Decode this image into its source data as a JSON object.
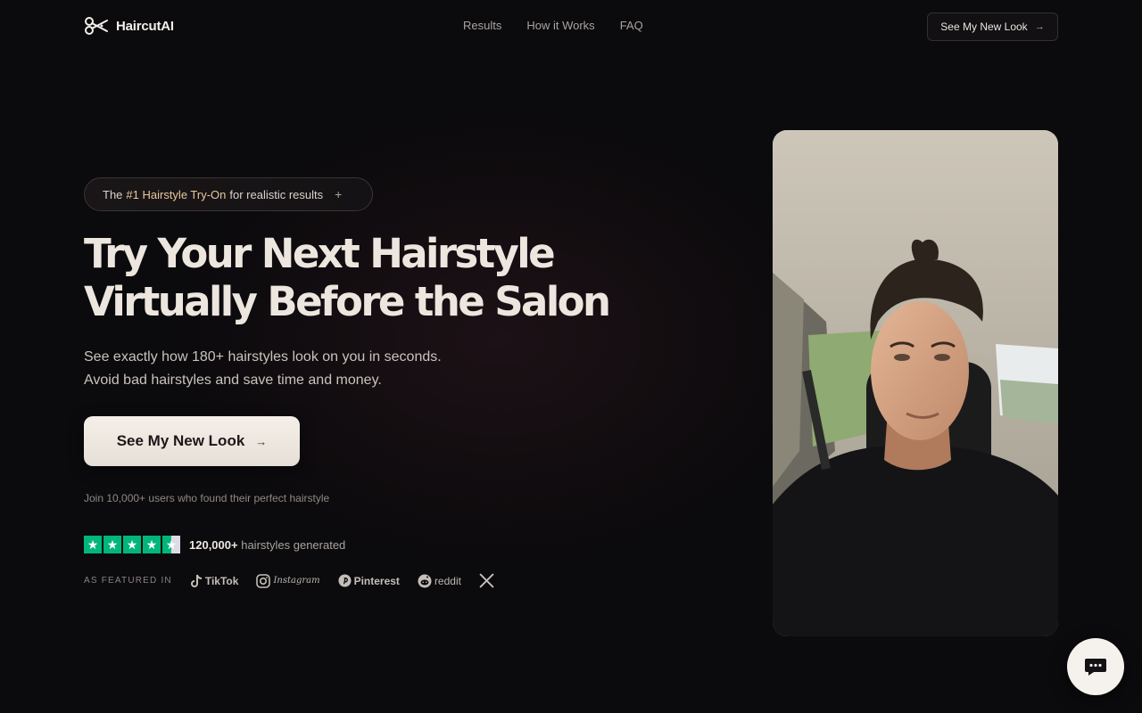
{
  "nav": {
    "brand": "HaircutAI",
    "links": [
      "Results",
      "How it Works",
      "FAQ"
    ],
    "cta": "See My New Look"
  },
  "hero": {
    "badge": {
      "prefix": "The",
      "highlight": "#1 Hairstyle Try-On",
      "suffix": "for realistic results"
    },
    "headline_line1": "Try Your Next Hairstyle",
    "headline_line2": "Virtually Before the Salon",
    "sub_line1": "See exactly how 180+ hairstyles look on you in seconds.",
    "sub_line2": "Avoid bad hairstyles and save time and money.",
    "cta": "See My New Look",
    "join": "Join 10,000+ users who found their perfect hairstyle",
    "rating": {
      "stars": 4.5,
      "count": "120,000+",
      "label": "hairstyles generated"
    },
    "featured_label": "AS FEATURED IN",
    "featured_brands": [
      "TikTok",
      "Instagram",
      "Pinterest",
      "reddit",
      "X"
    ]
  },
  "colors": {
    "background": "#0b0a0c",
    "accent_text": "#e7c99b",
    "cta_bg": "#f4efe9",
    "trustpilot": "#00b67a"
  },
  "icons": {
    "logo": "scissors-icon",
    "arrow": "arrow-right-icon",
    "plus": "plus-icon",
    "chat": "chat-bubble-icon"
  }
}
